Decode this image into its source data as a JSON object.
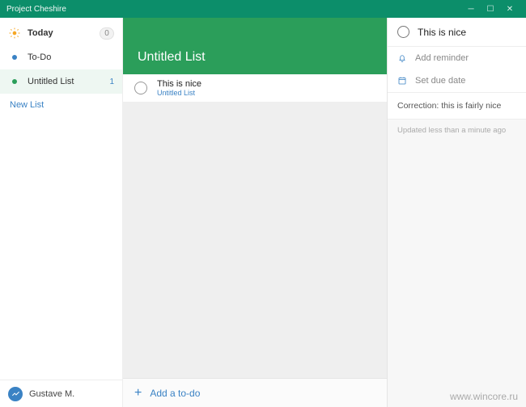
{
  "window": {
    "title": "Project Cheshire"
  },
  "sidebar": {
    "today": {
      "label": "Today",
      "count": "0"
    },
    "todo": {
      "label": "To-Do"
    },
    "untitled": {
      "label": "Untitled List",
      "count": "1"
    },
    "newList": "New List",
    "user": "Gustave M."
  },
  "list": {
    "title": "Untitled List",
    "task": {
      "title": "This is nice",
      "listName": "Untitled List"
    },
    "addPlaceholder": "Add a to-do"
  },
  "detail": {
    "title": "This is nice",
    "addReminder": "Add reminder",
    "setDueDate": "Set due date",
    "note": "Correction: this is fairly nice",
    "updated": "Updated less than a minute ago"
  },
  "watermark": "www.wincore.ru"
}
